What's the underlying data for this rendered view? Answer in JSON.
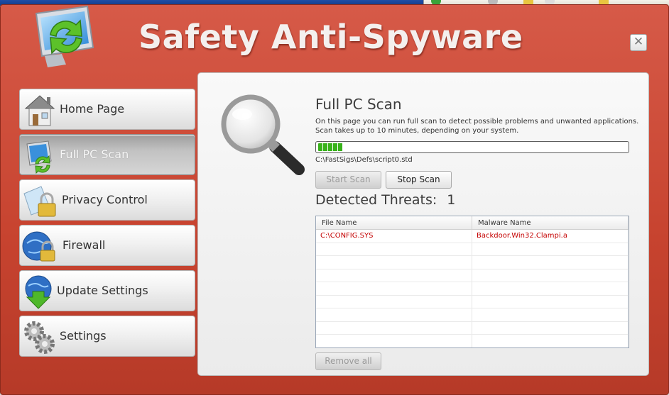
{
  "app": {
    "title": "Safety Anti-Spyware"
  },
  "sidebar": {
    "items": [
      {
        "label": "Home Page",
        "active": false
      },
      {
        "label": "Full PC Scan",
        "active": true
      },
      {
        "label": "Privacy Control",
        "active": false
      },
      {
        "label": "Firewall",
        "active": false
      },
      {
        "label": "Update Settings",
        "active": false
      },
      {
        "label": "Settings",
        "active": false
      }
    ]
  },
  "scan": {
    "title": "Full PC Scan",
    "description": "On this page you can run full scan to detect possible problems and unwanted applications. Scan takes up to 10 minutes, depending on your system.",
    "progress": 0.08,
    "current_file": "C:\\FastSigs\\Defs\\script0.std",
    "start_label": "Start Scan",
    "stop_label": "Stop Scan"
  },
  "threats": {
    "label": "Detected Threats:",
    "count": "1",
    "columns": [
      "File Name",
      "Malware Name"
    ],
    "rows": [
      {
        "file": "C:\\CONFIG.SYS",
        "malware": "Backdoor.Win32.Clampi.a"
      }
    ],
    "remove_all_label": "Remove all"
  },
  "colors": {
    "window_red": "#c7432f",
    "threat_text": "#c40000",
    "progress_green": "#38b21b"
  },
  "icons": {
    "logo": "monitor-refresh-icon",
    "home": "house-icon",
    "scan": "monitor-scan-icon",
    "privacy": "padlock-icon",
    "firewall": "globe-lock-icon",
    "update": "globe-download-icon",
    "settings": "gears-icon",
    "magnifier": "magnifier-icon"
  }
}
